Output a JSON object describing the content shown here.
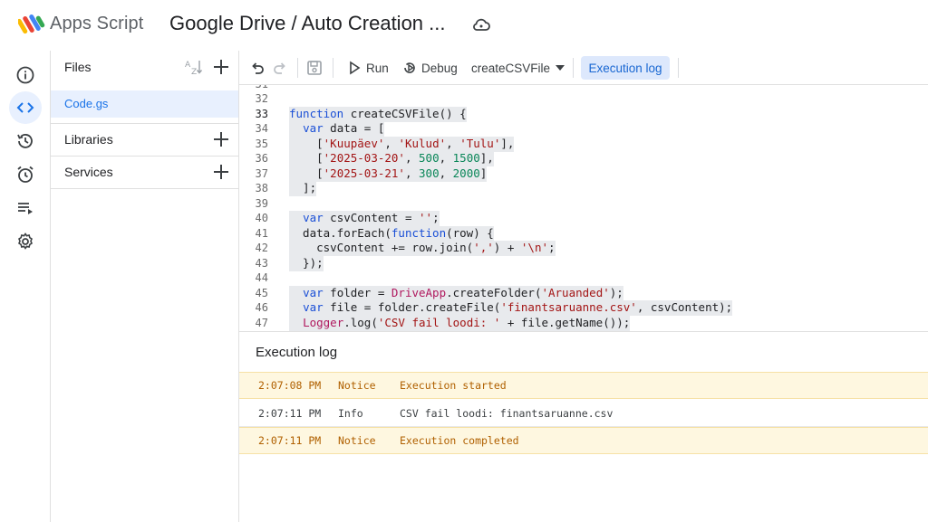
{
  "header": {
    "app_name": "Apps Script",
    "project_title": "Google Drive / Auto Creation ..."
  },
  "colors": {
    "accent": "#1a73e8",
    "notice_bg": "#fef7e0",
    "notice_text": "#b06000",
    "selected_bg": "#e8f0fe"
  },
  "rail": {
    "icons": [
      "info-icon",
      "code-icon",
      "history-icon",
      "alarm-icon",
      "executions-icon",
      "gear-icon"
    ],
    "active": "code-icon"
  },
  "files_panel": {
    "files_label": "Files",
    "file_items": [
      {
        "label": "Code.gs"
      }
    ],
    "libraries_label": "Libraries",
    "services_label": "Services"
  },
  "toolbar": {
    "run_label": "Run",
    "debug_label": "Debug",
    "function_select": "createCSVFile",
    "execution_log_label": "Execution log"
  },
  "editor": {
    "current_line": 33
  },
  "execution_log": {
    "title": "Execution log",
    "rows": [
      {
        "time": "2:07:08 PM",
        "level": "Notice",
        "message": "Execution started"
      },
      {
        "time": "2:07:11 PM",
        "level": "Info",
        "message": "CSV fail loodi: finantsaruanne.csv"
      },
      {
        "time": "2:07:11 PM",
        "level": "Notice",
        "message": "Execution completed"
      }
    ]
  }
}
